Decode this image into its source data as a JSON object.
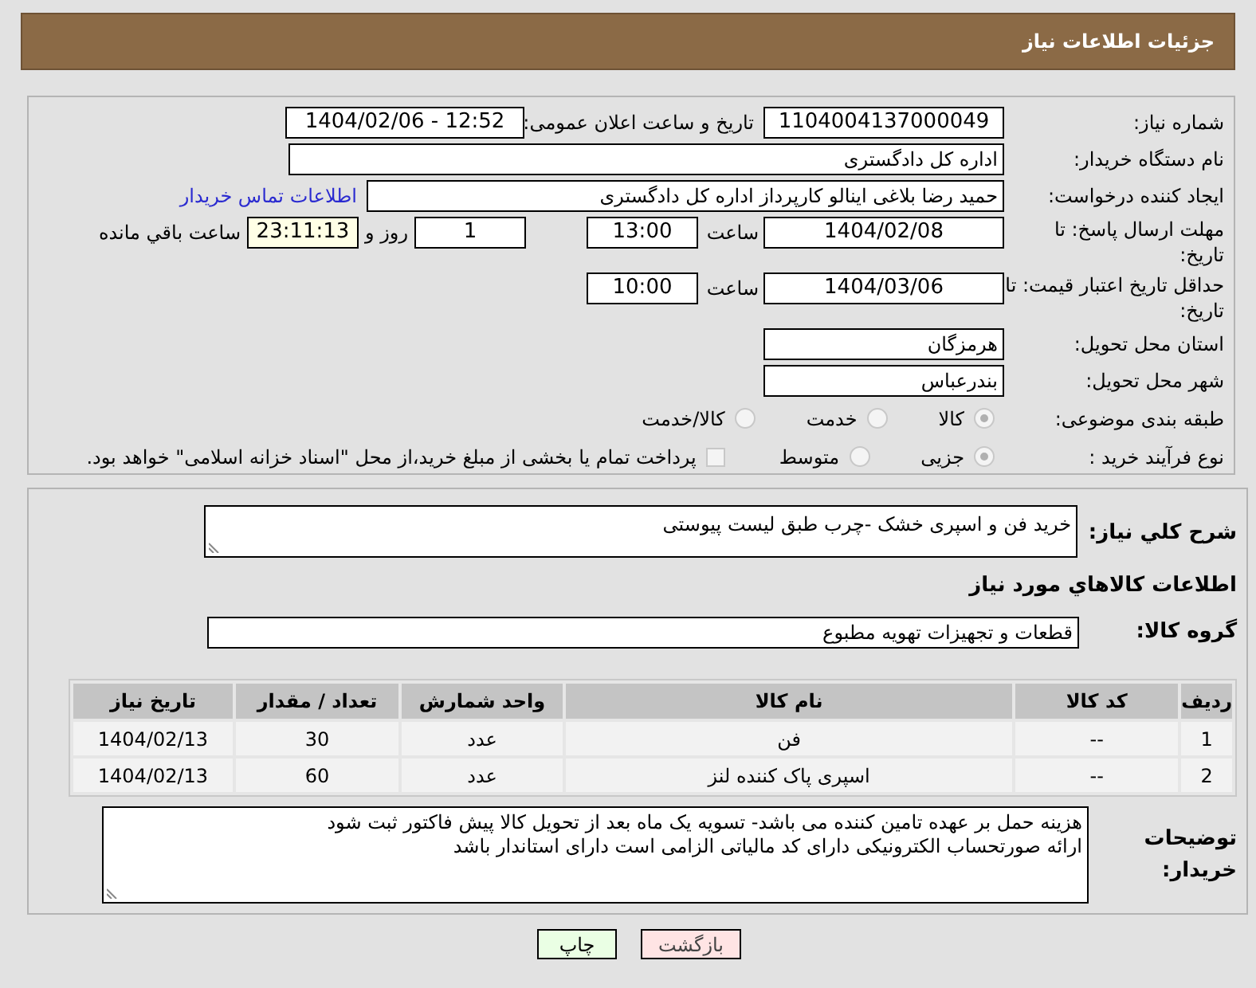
{
  "header": {
    "title": "جزئیات اطلاعات نیاز"
  },
  "need_number": {
    "label": "شماره نیاز:",
    "value": "1104004137000049"
  },
  "announce": {
    "label": "تاریخ و ساعت اعلان عمومی:",
    "value": "1404/02/06 - 12:52"
  },
  "buyer_org": {
    "label": "نام دستگاه خریدار:",
    "value": "اداره کل دادگستری"
  },
  "requester": {
    "label": "ایجاد کننده درخواست:",
    "value": "حمید رضا  بلاغی اینالو کارپرداز اداره کل دادگستری",
    "link": "اطلاعات تماس خریدار"
  },
  "deadline": {
    "label": "مهلت ارسال پاسخ: تا تاریخ:",
    "date": "1404/02/08",
    "time_label": "ساعت",
    "time": "13:00",
    "days": "1",
    "days_label": "روز و",
    "remaining": "23:11:13",
    "remaining_label": "ساعت باقي مانده"
  },
  "validity": {
    "label": "حداقل تاریخ اعتبار قیمت: تا تاریخ:",
    "date": "1404/03/06",
    "time_label": "ساعت",
    "time": "10:00"
  },
  "province": {
    "label": "استان محل تحویل:",
    "value": "هرمزگان"
  },
  "city": {
    "label": "شهر محل تحویل:",
    "value": "بندرعباس"
  },
  "category": {
    "label": "طبقه بندی موضوعی:",
    "options": [
      {
        "label": "کالا",
        "selected": true
      },
      {
        "label": "خدمت",
        "selected": false
      },
      {
        "label": "کالا/خدمت",
        "selected": false
      }
    ]
  },
  "process": {
    "label": "نوع فرآیند خرید :",
    "options": [
      {
        "label": "جزیی",
        "selected": true
      },
      {
        "label": "متوسط",
        "selected": false
      }
    ],
    "payment": {
      "label": "پرداخت تمام یا بخشی از مبلغ خرید،از محل \"اسناد خزانه اسلامی\" خواهد بود.",
      "checked": false
    }
  },
  "summary": {
    "label": "شرح کلي نياز:",
    "value": "خرید فن و اسپری خشک -چرب طبق لیست پیوستی"
  },
  "goods_title": "اطلاعات کالاهاي مورد نياز",
  "goods_group": {
    "label": "گروه کالا:",
    "value": "قطعات و تجهیزات تهویه مطبوع"
  },
  "table": {
    "columns": [
      "ردیف",
      "کد کالا",
      "نام کالا",
      "واحد شمارش",
      "تعداد / مقدار",
      "تاریخ نیاز"
    ],
    "rows": [
      [
        "1",
        "--",
        "فن",
        "عدد",
        "30",
        "1404/02/13"
      ],
      [
        "2",
        "--",
        "اسپری پاک کننده لنز",
        "عدد",
        "60",
        "1404/02/13"
      ]
    ]
  },
  "buyer_notes": {
    "label": "توضیحات خریدار:",
    "lines": [
      "هزینه حمل بر عهده تامین کننده می باشد- تسویه یک ماه بعد از تحویل کالا پیش فاکتور ثبت شود",
      "ارائه صورتحساب الکترونیکی دارای کد مالیاتی الزامی است دارای استاندار باشد"
    ]
  },
  "buttons": [
    {
      "label": "بازگشت",
      "kind": "back"
    },
    {
      "label": "چاپ",
      "kind": "print"
    }
  ]
}
